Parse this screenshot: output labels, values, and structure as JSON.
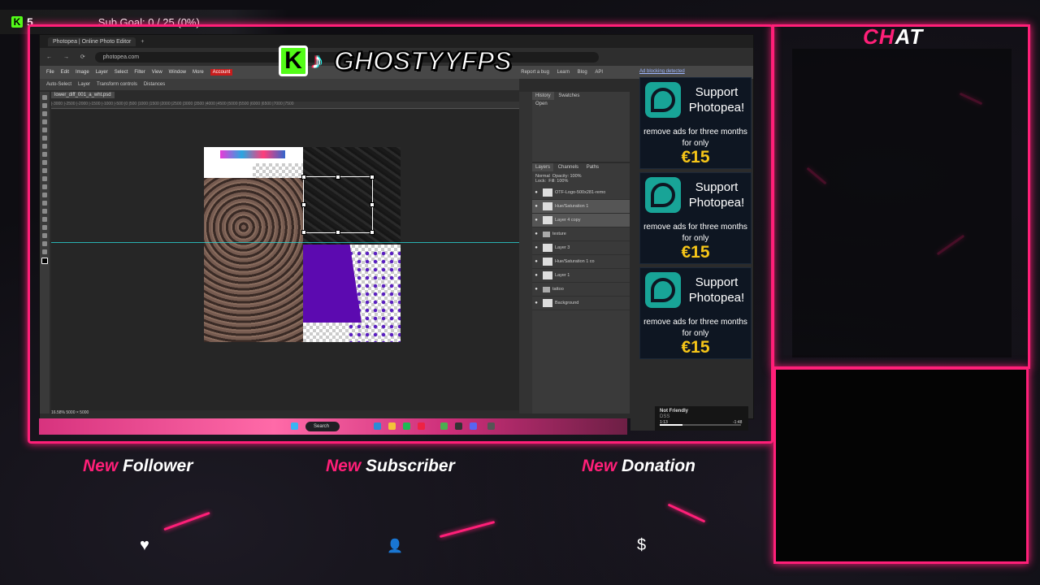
{
  "sub_goal": {
    "badge": "K",
    "count": "5",
    "text": "Sub Goal: 0 / 25 (0%)"
  },
  "logo": {
    "kick_letter": "K",
    "tiktok_glyph": "♪",
    "name": "GHOSTYYFPS"
  },
  "browser": {
    "tab_title": "Photopea | Online Photo Editor",
    "new_tab": "+",
    "url": "photopea.com",
    "nav_icons": "← → ⟳"
  },
  "photopea": {
    "menu": [
      "File",
      "Edit",
      "Image",
      "Layer",
      "Select",
      "Filter",
      "View",
      "Window",
      "More"
    ],
    "account": "Account",
    "right_links": [
      "Report a bug",
      "Learn",
      "Blog",
      "API"
    ],
    "toolbar": {
      "auto_select": "Auto-Select",
      "layer": "Layer",
      "transform": "Transform controls",
      "distances": "Distances"
    },
    "doc_tab": "lower_diff_001_a_wht.psd",
    "ruler": "|-3000 |-2500 |-2000 |-1500 |-1000 |-500 |0 |500 |1000 |1500 |2000 |2500 |3000 |3500 |4000 |4500 |5000 |5500 |6000 |6500 |7000 |7500",
    "status": "16.58%  5000 × 5000",
    "history": {
      "tab1": "History",
      "tab2": "Swatches",
      "item": "Open"
    },
    "layers_tabs": [
      "Layers",
      "Channels",
      "Paths"
    ],
    "blend": "Normal",
    "opacity": "Opacity: 100%",
    "lock": "Lock:",
    "fill": "Fill: 100%",
    "layers": [
      {
        "name": "OTF-Logo-500x281-remo",
        "type": "layer",
        "selected": false
      },
      {
        "name": "Hue/Saturation 1",
        "type": "adjust",
        "selected": true
      },
      {
        "name": "Layer 4 copy",
        "type": "layer",
        "selected": true
      },
      {
        "name": "texture",
        "type": "folder",
        "selected": false
      },
      {
        "name": "Layer 3",
        "type": "layer",
        "selected": false
      },
      {
        "name": "Hue/Saturation 1 co",
        "type": "adjust",
        "selected": false
      },
      {
        "name": "Layer 1",
        "type": "layer",
        "selected": false
      },
      {
        "name": "tattoo",
        "type": "folder",
        "selected": false
      },
      {
        "name": "Background",
        "type": "layer",
        "selected": false
      }
    ]
  },
  "ads": {
    "notice": "Ad blocking detected",
    "items": [
      {
        "title": "Support Photopea!",
        "line": "remove ads for three months for only",
        "price": "€15"
      },
      {
        "title": "Support Photopea!",
        "line": "remove ads for three months for only",
        "price": "€15"
      },
      {
        "title": "Support Photopea!",
        "line": "remove ads for three months for only",
        "price": "€15"
      }
    ]
  },
  "taskbar": {
    "search": "Search"
  },
  "media": {
    "title": "Not Friendly",
    "artist": "DSS",
    "elapsed": "1:13",
    "remaining": "-1:48",
    "progress": 0.28
  },
  "chat": {
    "title_accent": "CH",
    "title_rest": "AT"
  },
  "alerts": [
    {
      "new": "New",
      "label": "Follower",
      "icon": "♥"
    },
    {
      "new": "New",
      "label": "Subscriber",
      "icon": "👤"
    },
    {
      "new": "New",
      "label": "Donation",
      "icon": "$"
    }
  ],
  "colors": {
    "accent": "#ff1f78",
    "kick_green": "#53fc18",
    "ad_price": "#f5c518",
    "photopea_teal": "#18a497"
  }
}
